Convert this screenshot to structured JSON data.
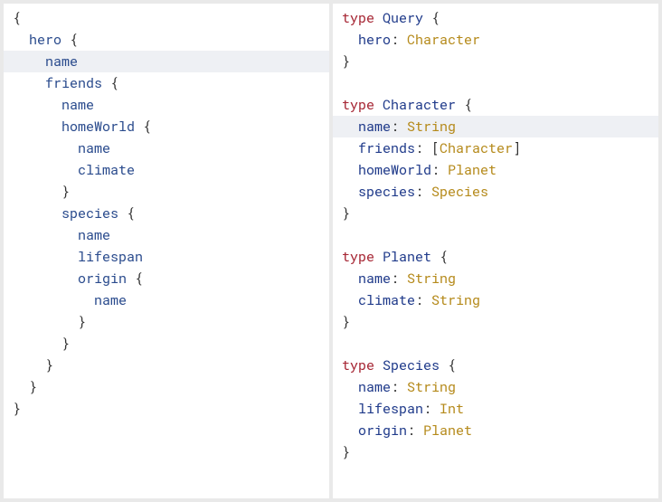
{
  "query": {
    "lines": [
      {
        "i": 0,
        "tokens": [
          {
            "t": "{",
            "c": "br"
          }
        ]
      },
      {
        "i": 1,
        "tokens": [
          {
            "t": "hero",
            "c": "qf"
          },
          {
            "t": " {",
            "c": "br"
          }
        ]
      },
      {
        "i": 2,
        "hl": true,
        "tokens": [
          {
            "t": "name",
            "c": "qf"
          }
        ]
      },
      {
        "i": 2,
        "tokens": [
          {
            "t": "friends",
            "c": "qf"
          },
          {
            "t": " {",
            "c": "br"
          }
        ]
      },
      {
        "i": 3,
        "tokens": [
          {
            "t": "name",
            "c": "qf"
          }
        ]
      },
      {
        "i": 3,
        "tokens": [
          {
            "t": "homeWorld",
            "c": "qf"
          },
          {
            "t": " {",
            "c": "br"
          }
        ]
      },
      {
        "i": 4,
        "tokens": [
          {
            "t": "name",
            "c": "qf"
          }
        ]
      },
      {
        "i": 4,
        "tokens": [
          {
            "t": "climate",
            "c": "qf"
          }
        ]
      },
      {
        "i": 3,
        "tokens": [
          {
            "t": "}",
            "c": "br"
          }
        ]
      },
      {
        "i": 3,
        "tokens": [
          {
            "t": "species",
            "c": "qf"
          },
          {
            "t": " {",
            "c": "br"
          }
        ]
      },
      {
        "i": 4,
        "tokens": [
          {
            "t": "name",
            "c": "qf"
          }
        ]
      },
      {
        "i": 4,
        "tokens": [
          {
            "t": "lifespan",
            "c": "qf"
          }
        ]
      },
      {
        "i": 4,
        "tokens": [
          {
            "t": "origin",
            "c": "qf"
          },
          {
            "t": " {",
            "c": "br"
          }
        ]
      },
      {
        "i": 5,
        "tokens": [
          {
            "t": "name",
            "c": "qf"
          }
        ]
      },
      {
        "i": 4,
        "tokens": [
          {
            "t": "}",
            "c": "br"
          }
        ]
      },
      {
        "i": 3,
        "tokens": [
          {
            "t": "}",
            "c": "br"
          }
        ]
      },
      {
        "i": 2,
        "tokens": [
          {
            "t": "}",
            "c": "br"
          }
        ]
      },
      {
        "i": 1,
        "tokens": [
          {
            "t": "}",
            "c": "br"
          }
        ]
      },
      {
        "i": 0,
        "tokens": [
          {
            "t": "}",
            "c": "br"
          }
        ]
      }
    ]
  },
  "schema": {
    "lines": [
      {
        "i": 0,
        "tokens": [
          {
            "t": "type ",
            "c": "kw"
          },
          {
            "t": "Query",
            "c": "tn"
          },
          {
            "t": " {",
            "c": "br"
          }
        ]
      },
      {
        "i": 1,
        "tokens": [
          {
            "t": "hero",
            "c": "tn"
          },
          {
            "t": ": ",
            "c": "br"
          },
          {
            "t": "Character",
            "c": "ft"
          }
        ]
      },
      {
        "i": 0,
        "tokens": [
          {
            "t": "}",
            "c": "br"
          }
        ]
      },
      {
        "blank": true
      },
      {
        "i": 0,
        "tokens": [
          {
            "t": "type ",
            "c": "kw"
          },
          {
            "t": "Character",
            "c": "tn"
          },
          {
            "t": " {",
            "c": "br"
          }
        ]
      },
      {
        "i": 1,
        "hl": true,
        "tokens": [
          {
            "t": "name",
            "c": "tn"
          },
          {
            "t": ": ",
            "c": "br"
          },
          {
            "t": "String",
            "c": "ft"
          }
        ]
      },
      {
        "i": 1,
        "tokens": [
          {
            "t": "friends",
            "c": "tn"
          },
          {
            "t": ": [",
            "c": "br"
          },
          {
            "t": "Character",
            "c": "ft"
          },
          {
            "t": "]",
            "c": "br"
          }
        ]
      },
      {
        "i": 1,
        "tokens": [
          {
            "t": "homeWorld",
            "c": "tn"
          },
          {
            "t": ": ",
            "c": "br"
          },
          {
            "t": "Planet",
            "c": "ft"
          }
        ]
      },
      {
        "i": 1,
        "tokens": [
          {
            "t": "species",
            "c": "tn"
          },
          {
            "t": ": ",
            "c": "br"
          },
          {
            "t": "Species",
            "c": "ft"
          }
        ]
      },
      {
        "i": 0,
        "tokens": [
          {
            "t": "}",
            "c": "br"
          }
        ]
      },
      {
        "blank": true
      },
      {
        "i": 0,
        "tokens": [
          {
            "t": "type ",
            "c": "kw"
          },
          {
            "t": "Planet",
            "c": "tn"
          },
          {
            "t": " {",
            "c": "br"
          }
        ]
      },
      {
        "i": 1,
        "tokens": [
          {
            "t": "name",
            "c": "tn"
          },
          {
            "t": ": ",
            "c": "br"
          },
          {
            "t": "String",
            "c": "ft"
          }
        ]
      },
      {
        "i": 1,
        "tokens": [
          {
            "t": "climate",
            "c": "tn"
          },
          {
            "t": ": ",
            "c": "br"
          },
          {
            "t": "String",
            "c": "ft"
          }
        ]
      },
      {
        "i": 0,
        "tokens": [
          {
            "t": "}",
            "c": "br"
          }
        ]
      },
      {
        "blank": true
      },
      {
        "i": 0,
        "tokens": [
          {
            "t": "type ",
            "c": "kw"
          },
          {
            "t": "Species",
            "c": "tn"
          },
          {
            "t": " {",
            "c": "br"
          }
        ]
      },
      {
        "i": 1,
        "tokens": [
          {
            "t": "name",
            "c": "tn"
          },
          {
            "t": ": ",
            "c": "br"
          },
          {
            "t": "String",
            "c": "ft"
          }
        ]
      },
      {
        "i": 1,
        "tokens": [
          {
            "t": "lifespan",
            "c": "tn"
          },
          {
            "t": ": ",
            "c": "br"
          },
          {
            "t": "Int",
            "c": "ft"
          }
        ]
      },
      {
        "i": 1,
        "tokens": [
          {
            "t": "origin",
            "c": "tn"
          },
          {
            "t": ": ",
            "c": "br"
          },
          {
            "t": "Planet",
            "c": "ft"
          }
        ]
      },
      {
        "i": 0,
        "tokens": [
          {
            "t": "}",
            "c": "br"
          }
        ]
      }
    ]
  }
}
